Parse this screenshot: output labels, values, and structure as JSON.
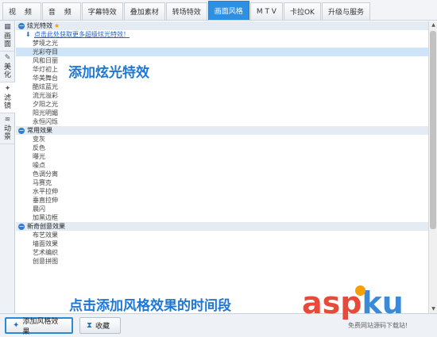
{
  "tabs": [
    {
      "label": "视 频",
      "active": false
    },
    {
      "label": "音 频",
      "active": false
    },
    {
      "label": "字幕特效",
      "active": false
    },
    {
      "label": "叠加素材",
      "active": false
    },
    {
      "label": "转场特效",
      "active": false
    },
    {
      "label": "画面风格",
      "active": true
    },
    {
      "label": "M T V",
      "active": false
    },
    {
      "label": "卡拉OK",
      "active": false
    },
    {
      "label": "升级与服务",
      "active": false
    }
  ],
  "side_tabs": [
    {
      "label": "画面",
      "icon": "grid-icon"
    },
    {
      "label": "美化",
      "icon": "wand-icon"
    },
    {
      "label": "滤镜",
      "icon": "sparkle-icon"
    },
    {
      "label": "动景",
      "icon": "wave-icon"
    }
  ],
  "sections": [
    {
      "title": "炫光特效",
      "star": "★",
      "download_link": "点击此处获取更多超级炫光特效！",
      "items": [
        "梦境之光",
        "光彩夺目",
        "风和日丽",
        "华灯初上",
        "华美舞台",
        "酷炫蓝光",
        "流光溢彩",
        "夕阳之光",
        "阳光明媚",
        "永恒闪烁"
      ],
      "selected": "光彩夺目"
    },
    {
      "title": "常用效果",
      "items": [
        "变灰",
        "反色",
        "曝光",
        "噪点",
        "色调分离",
        "马赛克",
        "水平拉伸",
        "垂直拉伸",
        "晨闪",
        "加黑边框"
      ]
    },
    {
      "title": "新奇创意效果",
      "items": [
        "布艺效果",
        "墙面效果",
        "艺术编织",
        "创意拼图"
      ]
    }
  ],
  "annotations": {
    "top": "添加炫光特效",
    "bottom": "点击添加风格效果的时间段"
  },
  "buttons": {
    "add_style": "添加风格效果",
    "favorite": "收藏"
  },
  "watermark": {
    "asp": "asp",
    "ku": "ku",
    "sub": "免费网站源码下载站!"
  },
  "colors": {
    "accent": "#2f8fe0",
    "selected_row": "#cfe4f7",
    "section_header": "#e4ebf3",
    "annotation": "#1f77d4",
    "watermark_red": "#e64a38",
    "watermark_blue": "#3a8ad8"
  }
}
